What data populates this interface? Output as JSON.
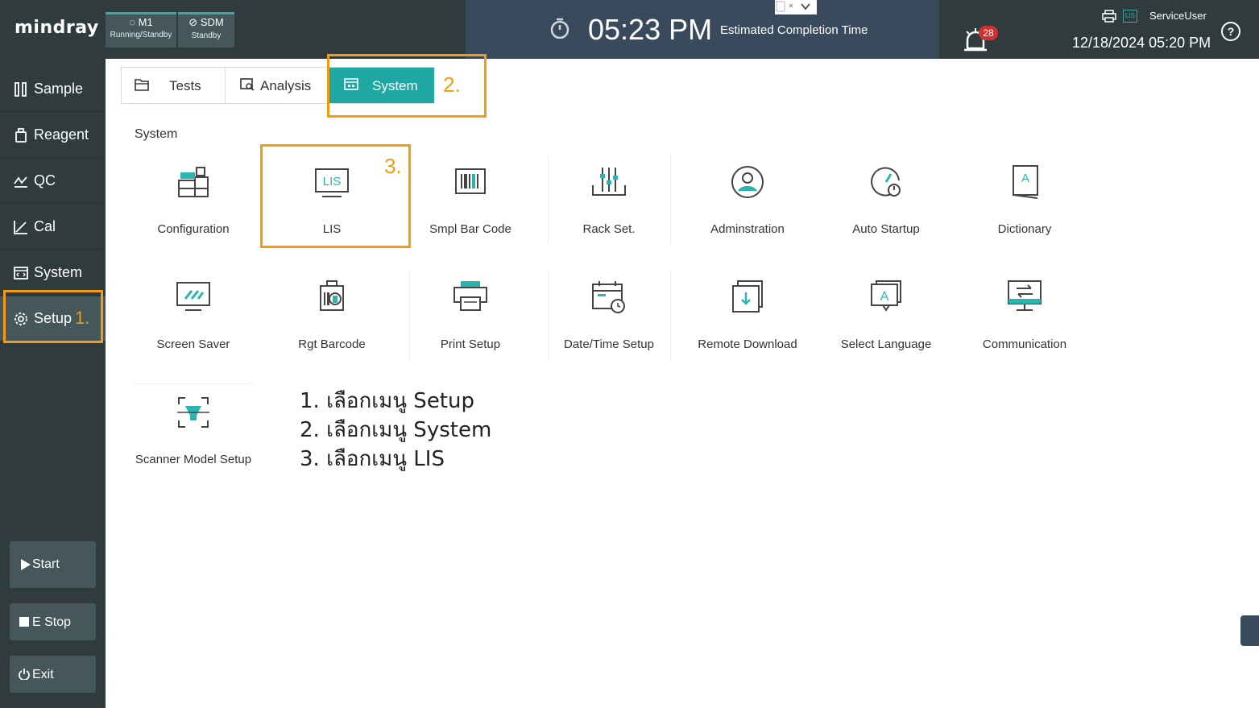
{
  "header": {
    "brand": "mindray",
    "modules": [
      {
        "name": "M1",
        "status": "Running/Standby"
      },
      {
        "name": "SDM",
        "status": "Standby"
      }
    ],
    "time": "05:23 PM",
    "time_caption": "Estimated Completion Time",
    "alarm_count": "28",
    "lis_badge": "LIS",
    "user": "ServiceUser",
    "datetime": "12/18/2024 05:20 PM",
    "help": "?"
  },
  "sidebar": {
    "items": [
      {
        "label": "Sample"
      },
      {
        "label": "Reagent"
      },
      {
        "label": "QC"
      },
      {
        "label": "Cal"
      },
      {
        "label": "System"
      },
      {
        "label": "Setup"
      }
    ],
    "buttons": {
      "start": "Start",
      "estop": "E Stop",
      "exit": "Exit"
    }
  },
  "tabs": [
    {
      "label": "Tests"
    },
    {
      "label": "Analysis"
    },
    {
      "label": "System",
      "active": true
    }
  ],
  "section_title": "System",
  "tiles": [
    {
      "label": "Configuration",
      "icon": "configuration-icon"
    },
    {
      "label": "LIS",
      "icon": "lis-icon"
    },
    {
      "label": "Smpl Bar Code",
      "icon": "barcode-icon"
    },
    {
      "label": "Rack Set.",
      "icon": "rack-icon"
    },
    {
      "label": "Adminstration",
      "icon": "user-icon"
    },
    {
      "label": "Auto Startup",
      "icon": "auto-startup-icon"
    },
    {
      "label": "Dictionary",
      "icon": "dictionary-icon"
    },
    {
      "label": "Screen Saver",
      "icon": "screen-saver-icon"
    },
    {
      "label": "Rgt  Barcode",
      "icon": "reagent-barcode-icon"
    },
    {
      "label": "Print Setup",
      "icon": "printer-icon"
    },
    {
      "label": "Date/Time Setup",
      "icon": "calendar-clock-icon"
    },
    {
      "label": "Remote Download",
      "icon": "download-icon"
    },
    {
      "label": "Select Language",
      "icon": "language-icon"
    },
    {
      "label": "Communication",
      "icon": "communication-icon"
    },
    {
      "label": "Scanner Model Setup",
      "icon": "scanner-icon"
    }
  ],
  "annotations": {
    "step1": "1.",
    "step2": "2.",
    "step3": "3.",
    "instructions": [
      "1. เลือกเมนู Setup",
      "2. เลือกเมนู System",
      "3. เลือกเมนู LIS"
    ]
  },
  "colors": {
    "accent": "#1fa8a3",
    "highlight": "#f39c12",
    "header": "#394a5c",
    "sidebar": "#2f3b3d"
  }
}
